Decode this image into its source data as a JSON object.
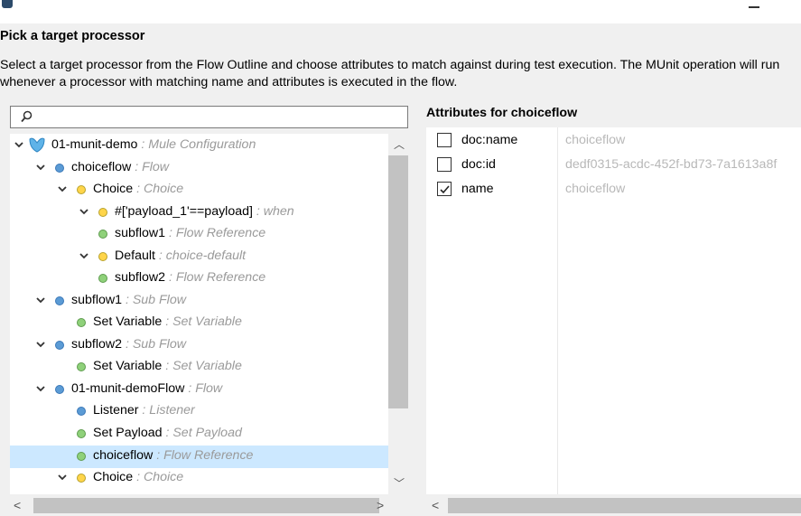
{
  "dialog": {
    "title": "Pick a target processor",
    "description": "Select a target processor from the Flow Outline and choose attributes to match against during test execution. The MUnit operation will run whenever a processor with matching name and attributes is executed in the flow."
  },
  "search": {
    "placeholder": "",
    "value": ""
  },
  "tree": {
    "rows": [
      {
        "label": "01-munit-demo",
        "type": ": Mule Configuration",
        "icon": "mule-config-icon",
        "expanded": true
      },
      {
        "label": "choiceflow",
        "type": ": Flow",
        "icon": "flow-icon-blue",
        "expanded": true
      },
      {
        "label": "Choice",
        "type": ": Choice",
        "icon": "router-icon-yellow",
        "expanded": true
      },
      {
        "label": "#['payload_1'==payload]",
        "type": ": when",
        "icon": "router-icon-yellow",
        "expanded": true
      },
      {
        "label": "subflow1",
        "type": ": Flow Reference",
        "icon": "processor-icon-green"
      },
      {
        "label": "Default",
        "type": ": choice-default",
        "icon": "router-icon-yellow",
        "expanded": true
      },
      {
        "label": "subflow2",
        "type": ": Flow Reference",
        "icon": "processor-icon-green"
      },
      {
        "label": "subflow1",
        "type": ": Sub Flow",
        "icon": "flow-icon-blue",
        "expanded": true
      },
      {
        "label": "Set Variable",
        "type": ": Set Variable",
        "icon": "processor-icon-green"
      },
      {
        "label": "subflow2",
        "type": ": Sub Flow",
        "icon": "flow-icon-blue",
        "expanded": true
      },
      {
        "label": "Set Variable",
        "type": ": Set Variable",
        "icon": "processor-icon-green"
      },
      {
        "label": "01-munit-demoFlow",
        "type": ": Flow",
        "icon": "flow-icon-blue",
        "expanded": true
      },
      {
        "label": "Listener",
        "type": ": Listener",
        "icon": "source-icon-blue"
      },
      {
        "label": "Set Payload",
        "type": ": Set Payload",
        "icon": "processor-icon-green"
      },
      {
        "label": "choiceflow",
        "type": ": Flow Reference",
        "icon": "processor-icon-green",
        "selected": true
      },
      {
        "label": "Choice",
        "type": ": Choice",
        "icon": "router-icon-yellow",
        "expanded": true
      }
    ]
  },
  "attributes": {
    "title": "Attributes for choiceflow",
    "rows": [
      {
        "name": "doc:name",
        "value": "choiceflow",
        "checked": false
      },
      {
        "name": "doc:id",
        "value": "dedf0315-acdc-452f-bd73-7a1613a8f",
        "checked": false
      },
      {
        "name": "name",
        "value": "choiceflow",
        "checked": true
      }
    ]
  },
  "colors": {
    "selection": "#cce8ff",
    "flow_blue": "#5b9bd5",
    "router_yellow": "#ffd54a",
    "processor_green": "#8fd17a",
    "type_gray": "#9a9a9a"
  }
}
